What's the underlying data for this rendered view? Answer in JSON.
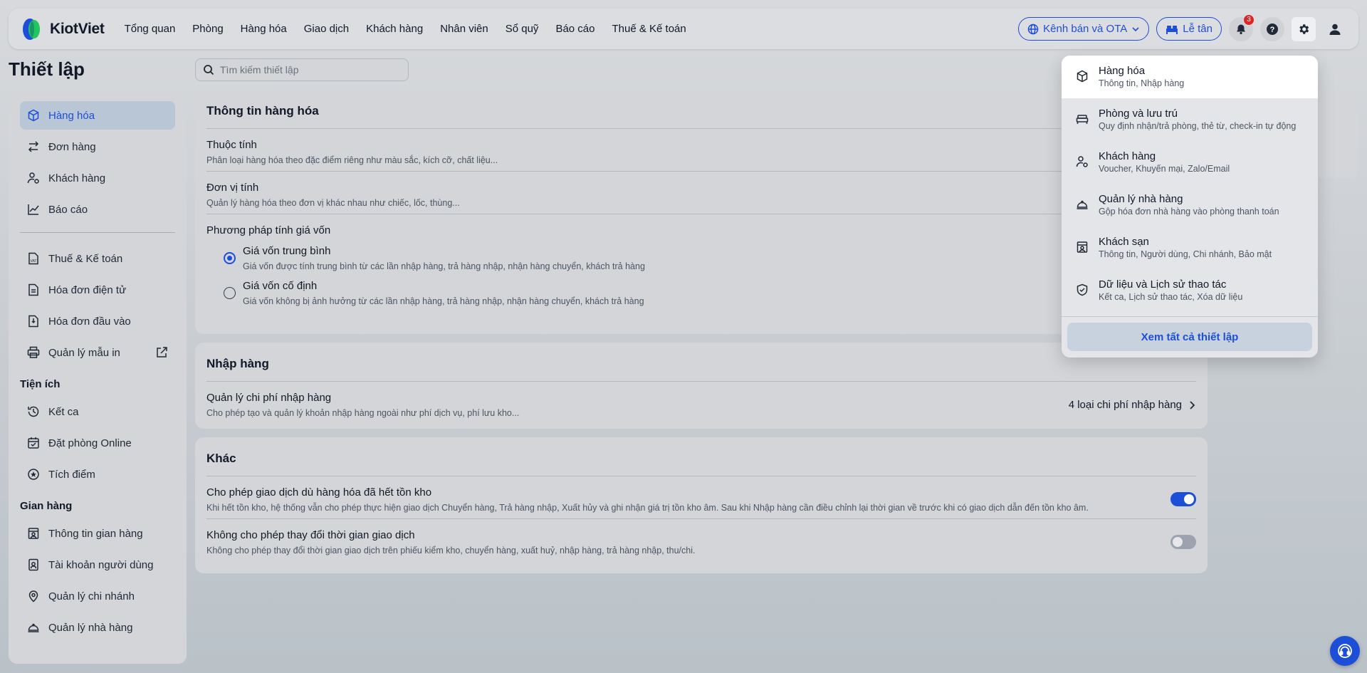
{
  "topbar": {
    "logo_text": "KiotViet",
    "nav": [
      "Tổng quan",
      "Phòng",
      "Hàng hóa",
      "Giao dịch",
      "Khách hàng",
      "Nhân viên",
      "Sổ quỹ",
      "Báo cáo",
      "Thuế & Kế toán"
    ],
    "channel_button": "Kênh bán và OTA",
    "reception_button": "Lễ tân",
    "notification_count": "3",
    "accent": "#1d4ed8"
  },
  "page": {
    "title": "Thiết lập",
    "search_placeholder": "Tìm kiếm thiết lập"
  },
  "sidebar": {
    "items": [
      {
        "label": "Hàng hóa",
        "icon": "box-icon",
        "active": true
      },
      {
        "label": "Đơn hàng",
        "icon": "swap-icon"
      },
      {
        "label": "Khách hàng",
        "icon": "user-gear-icon"
      },
      {
        "label": "Báo cáo",
        "icon": "chart-icon"
      }
    ],
    "items2": [
      {
        "label": "Thuế & Kế toán",
        "icon": "vat-doc-icon"
      },
      {
        "label": "Hóa đơn điện tử",
        "icon": "doc-icon"
      },
      {
        "label": "Hóa đơn đầu vào",
        "icon": "doc-import-icon"
      },
      {
        "label": "Quản lý mẫu in",
        "icon": "printer-icon"
      }
    ],
    "utilities_heading": "Tiện ích",
    "utilities": [
      {
        "label": "Kết ca",
        "icon": "history-icon"
      },
      {
        "label": "Đặt phòng Online",
        "icon": "calendar-check-icon"
      },
      {
        "label": "Tích điểm",
        "icon": "star-circle-icon"
      }
    ],
    "store_heading": "Gian hàng",
    "store": [
      {
        "label": "Thông tin gian hàng",
        "icon": "store-icon"
      },
      {
        "label": "Tài khoản người dùng",
        "icon": "id-card-icon"
      },
      {
        "label": "Quản lý chi nhánh",
        "icon": "location-icon"
      },
      {
        "label": "Quản lý nhà hàng",
        "icon": "cloche-icon"
      }
    ]
  },
  "goods_card": {
    "title": "Thông tin hàng hóa",
    "attributes_title": "Thuộc tính",
    "attributes_desc": "Phân loại hàng hóa theo đặc điểm riêng như màu sắc, kích cỡ, chất liệu...",
    "unit_title": "Đơn vị tính",
    "unit_desc": "Quản lý hàng hóa theo đơn vị khác nhau như chiếc, lốc, thùng...",
    "cost_title": "Phương pháp tính giá vốn",
    "cost_avg_title": "Giá vốn trung bình",
    "cost_avg_desc": "Giá vốn được tính trung bình từ các lần nhập hàng, trả hàng nhập, nhận hàng chuyển, khách trả hàng",
    "cost_fixed_title": "Giá vốn cố định",
    "cost_fixed_desc": "Giá vốn không bị ảnh hưởng từ các lần nhập hàng, trả hàng nhập, nhận hàng chuyển, khách trả hàng"
  },
  "import_card": {
    "title": "Nhập hàng",
    "cost_mgmt_title": "Quản lý chi phí nhập hàng",
    "cost_mgmt_desc": "Cho phép tạo và quản lý khoản nhập hàng ngoài như phí dịch vụ, phí lưu kho...",
    "cost_mgmt_value": "4 loại chi phí nhập hàng"
  },
  "other_card": {
    "title": "Khác",
    "allow_title": "Cho phép giao dịch dù hàng hóa đã hết tồn kho",
    "allow_desc": "Khi hết tồn kho, hệ thống vẫn cho phép thực hiện giao dịch Chuyển hàng, Trả hàng nhập, Xuất hủy và ghi nhận giá trị tồn kho âm. Sau khi Nhập hàng cần điều chỉnh lại thời gian về trước khi có giao dịch dẫn đến tồn kho âm.",
    "allow_on": true,
    "lock_title": "Không cho phép thay đổi thời gian giao dịch",
    "lock_desc": "Không cho phép thay đổi thời gian giao dịch trên phiếu kiểm kho, chuyển hàng, xuất huỷ, nhập hàng, trả hàng nhập, thu/chi.",
    "lock_on": false
  },
  "dropdown": {
    "items": [
      {
        "title": "Hàng hóa",
        "desc": "Thông tin, Nhập hàng",
        "icon": "box-icon",
        "active": true
      },
      {
        "title": "Phòng và lưu trú",
        "desc": "Quy định nhận/trả phòng, thẻ từ, check-in tự động",
        "icon": "bed-icon"
      },
      {
        "title": "Khách hàng",
        "desc": "Voucher, Khuyến mại, Zalo/Email",
        "icon": "user-gear-icon"
      },
      {
        "title": "Quản lý nhà hàng",
        "desc": "Gộp hóa đơn nhà hàng vào phòng thanh toán",
        "icon": "cloche-icon"
      },
      {
        "title": "Khách sạn",
        "desc": "Thông tin, Người dùng, Chi nhánh, Bảo mật",
        "icon": "store-icon"
      },
      {
        "title": "Dữ liệu và Lịch sử thao tác",
        "desc": "Kết ca, Lịch sử thao tác, Xóa dữ liệu",
        "icon": "shield-check-icon"
      }
    ],
    "cta": "Xem tất cả thiết lập"
  }
}
